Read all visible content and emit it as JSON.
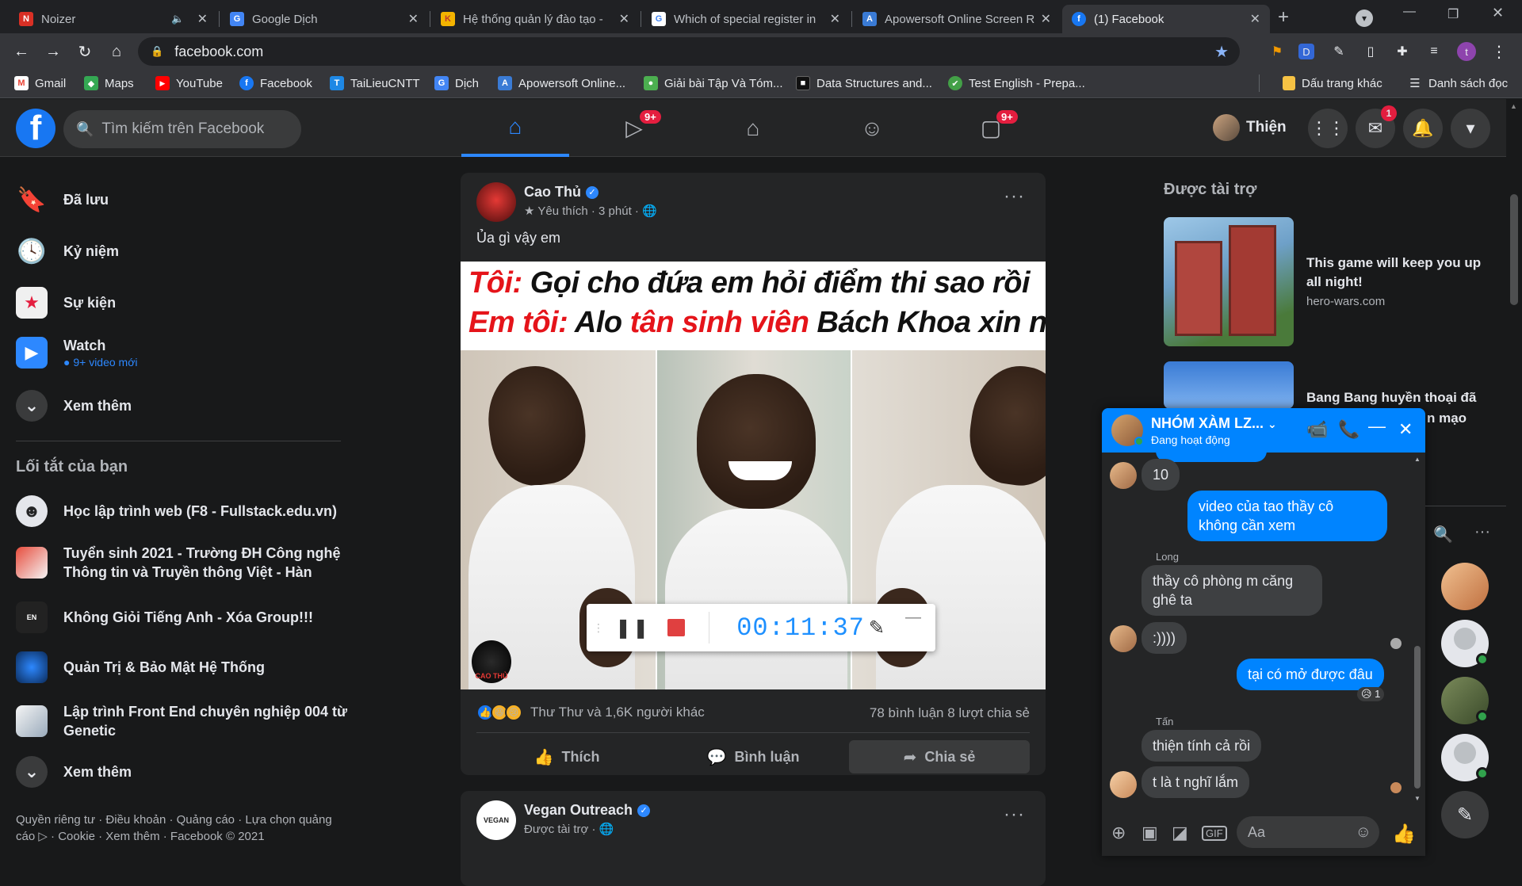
{
  "browser": {
    "tabs": [
      {
        "title": "Noizer",
        "icon": "N",
        "color": "#d93025"
      },
      {
        "title": "Google Dịch",
        "icon": "G",
        "color": "#4285f4"
      },
      {
        "title": "Hệ thống quản lý đào tạo -",
        "icon": "K",
        "color": "#c0392b"
      },
      {
        "title": "Which of special register in",
        "icon": "G",
        "color": "#ffffff"
      },
      {
        "title": "Apowersoft Online Screen R",
        "icon": "A",
        "color": "#3a7bd5"
      },
      {
        "title": "(1) Facebook",
        "icon": "f",
        "color": "#1877f2"
      }
    ],
    "url": "facebook.com",
    "bookmarks": [
      {
        "label": "Gmail",
        "icon": "M",
        "color": "#ea4335"
      },
      {
        "label": "Maps",
        "icon": "◆",
        "color": "#34a853"
      },
      {
        "label": "YouTube",
        "icon": "▶",
        "color": "#ff0000"
      },
      {
        "label": "Facebook",
        "icon": "f",
        "color": "#1877f2"
      },
      {
        "label": "TaiLieuCNTT",
        "icon": "T",
        "color": "#1e88e5"
      },
      {
        "label": "Dịch",
        "icon": "G",
        "color": "#4285f4"
      },
      {
        "label": "Apowersoft Online...",
        "icon": "A",
        "color": "#3a7bd5"
      },
      {
        "label": "Giải bài Tập Và Tóm...",
        "icon": "●",
        "color": "#4caf50"
      },
      {
        "label": "Data Structures and...",
        "icon": "■",
        "color": "#333333"
      },
      {
        "label": "Test English - Prepa...",
        "icon": "✔",
        "color": "#43a047"
      }
    ],
    "other_bookmarks": "Dấu trang khác",
    "reading_list": "Danh sách đọc"
  },
  "fb_header": {
    "search_placeholder": "Tìm kiếm trên Facebook",
    "video_badge": "9+",
    "gaming_badge": "9+",
    "profile_name": "Thiện",
    "messenger_badge": "1"
  },
  "sidebar": {
    "items": [
      {
        "label": "Đã lưu",
        "icon": "bookmark-icon"
      },
      {
        "label": "Kỷ niệm",
        "icon": "clock-icon"
      },
      {
        "label": "Sự kiện",
        "icon": "calendar-icon"
      },
      {
        "label": "Watch",
        "sub": "● 9+ video mới",
        "icon": "watch-icon"
      },
      {
        "label": "Xem thêm",
        "icon": "chevron-down-icon"
      }
    ],
    "shortcuts_title": "Lối tắt của bạn",
    "shortcuts": [
      {
        "label": "Học lập trình web (F8 - Fullstack.edu.vn)"
      },
      {
        "label": "Tuyển sinh 2021 - Trường ĐH Công nghệ Thông tin và Truyền thông Việt - Hàn"
      },
      {
        "label": "Không Giỏi Tiếng Anh - Xóa Group!!!"
      },
      {
        "label": "Quản Trị & Bảo Mật Hệ Thống"
      },
      {
        "label": "Lập trình Front End chuyên nghiệp 004 từ Genetic"
      }
    ],
    "see_more": "Xem thêm",
    "footer": "Quyền riêng tư · Điều khoản · Quảng cáo · Lựa chọn quảng cáo ▷ · Cookie · Xem thêm · Facebook © 2021"
  },
  "post": {
    "author": "Cao Thủ",
    "meta": "★ Yêu thích · 3 phút · 🌐",
    "text": "Ủa gì vậy em",
    "meme_line1_a": "Tôi:",
    "meme_line1_b": " Gọi cho đứa em hỏi điểm thi sao rồi",
    "meme_line2_a": "Em tôi:",
    "meme_line2_b": " Alo ",
    "meme_line2_c": "tân sinh viên",
    "meme_line2_d": " Bách Khoa xin nghe",
    "watermark": "CAO THỦ",
    "reactions_text": "Thư Thư và 1,6K người khác",
    "stats": "78 bình luận  8 lượt chia sẻ",
    "like": "Thích",
    "comment": "Bình luận",
    "share": "Chia sẻ"
  },
  "recorder": {
    "time": "00:11:37"
  },
  "post2": {
    "author": "Vegan Outreach",
    "meta": "Được tài trợ · 🌐"
  },
  "sponsored": {
    "title": "Được tài trợ",
    "ads": [
      {
        "title": "This game will keep you up all night!",
        "url": "hero-wars.com"
      },
      {
        "title": "Bang Bang huyền thoại đã",
        "tail": "n mạo"
      }
    ]
  },
  "chat": {
    "name": "NHÓM XÀM LZ...",
    "status": "Đang hoạt động",
    "messages": [
      {
        "from": "in",
        "text": "10"
      },
      {
        "from": "out",
        "text": "video của tao thầy cô không cần xem"
      },
      {
        "from": "in",
        "sender": "Long",
        "text": "thầy cô phòng m căng ghê ta"
      },
      {
        "from": "in",
        "text": ":))))"
      },
      {
        "from": "out",
        "text": "tại có mở được đâu",
        "reaction": "😥 1"
      },
      {
        "from": "in",
        "sender": "Tấn",
        "text": "thiện tính cả rồi"
      },
      {
        "from": "in",
        "text": "t là t nghĩ lắm"
      }
    ],
    "input_placeholder": "Aa"
  }
}
